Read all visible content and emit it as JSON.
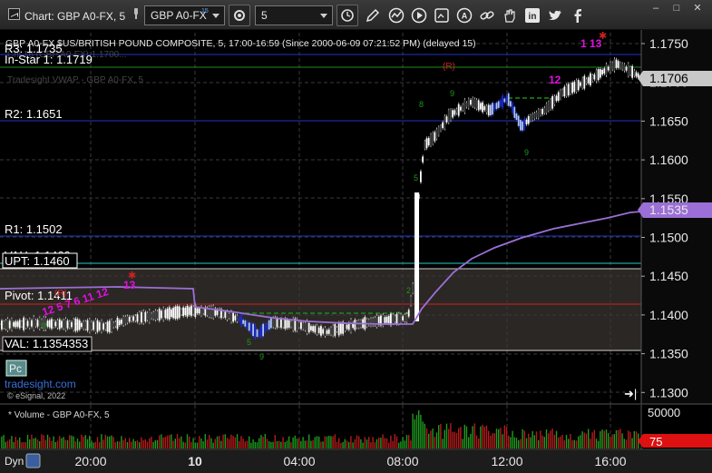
{
  "window": {
    "title": "Chart: GBP A0-FX, 5",
    "controls": [
      "–",
      "□",
      "✕"
    ]
  },
  "toolbar": {
    "symbol": "GBP A0-FX",
    "symbol_sup": "15",
    "interval": "5"
  },
  "chart": {
    "header": "GBP A0-FX $US/BRITISH POUND COMPOSITE, 5, 17:00-16:59 (Since 2000-06-09 07:21:52 PM) (delayed 15)",
    "header2": "Cnl 16 (GBP A0-FX) 1.1700...",
    "header3": "Tradesight VWAP - GBP A0-FX, 5",
    "levels": {
      "r3": "R3: 1.1735",
      "in_star": "In-Star 1: 1.1719",
      "r2": "R2: 1.1651",
      "r1": "R1: 1.1502",
      "vah": "VAH: 1.1460",
      "upt": "UPT: 1.1460",
      "pivot": "Pivot: 1.1411",
      "val": "VAL: 1.1354353"
    },
    "price_axis": [
      "1.1750",
      "1.1700",
      "1.1650",
      "1.1600",
      "1.1550",
      "1.1500",
      "1.1450",
      "1.1400",
      "1.1350",
      "1.1300"
    ],
    "last_price": "1.1706",
    "vwap_price": "1.1535",
    "time_axis": [
      "20:00",
      "10",
      "04:00",
      "08:00",
      "12:00",
      "16:00"
    ],
    "badge": "Pc",
    "watermark": "tradesight.com",
    "copyright": "© eSignal, 2022",
    "markers": {
      "r_label": "(R)",
      "r_label2": "(R)",
      "seq_left": "12 5 7 6 11 12",
      "seq_left13": "13",
      "seq_right": "12",
      "seq_right13": "1 13"
    },
    "volume_header": "* Volume - GBP A0-FX, 5",
    "volume_axis": "50000",
    "volume_last": "75",
    "dyn_label": "Dyn"
  },
  "colors": {
    "vwap": "#9b6fd6",
    "r_lines": "#2233cc",
    "green_lines": "#1a8a1a",
    "upt": "#22cccc",
    "pivot": "#cc2222",
    "magenta": "#e010e0"
  }
}
